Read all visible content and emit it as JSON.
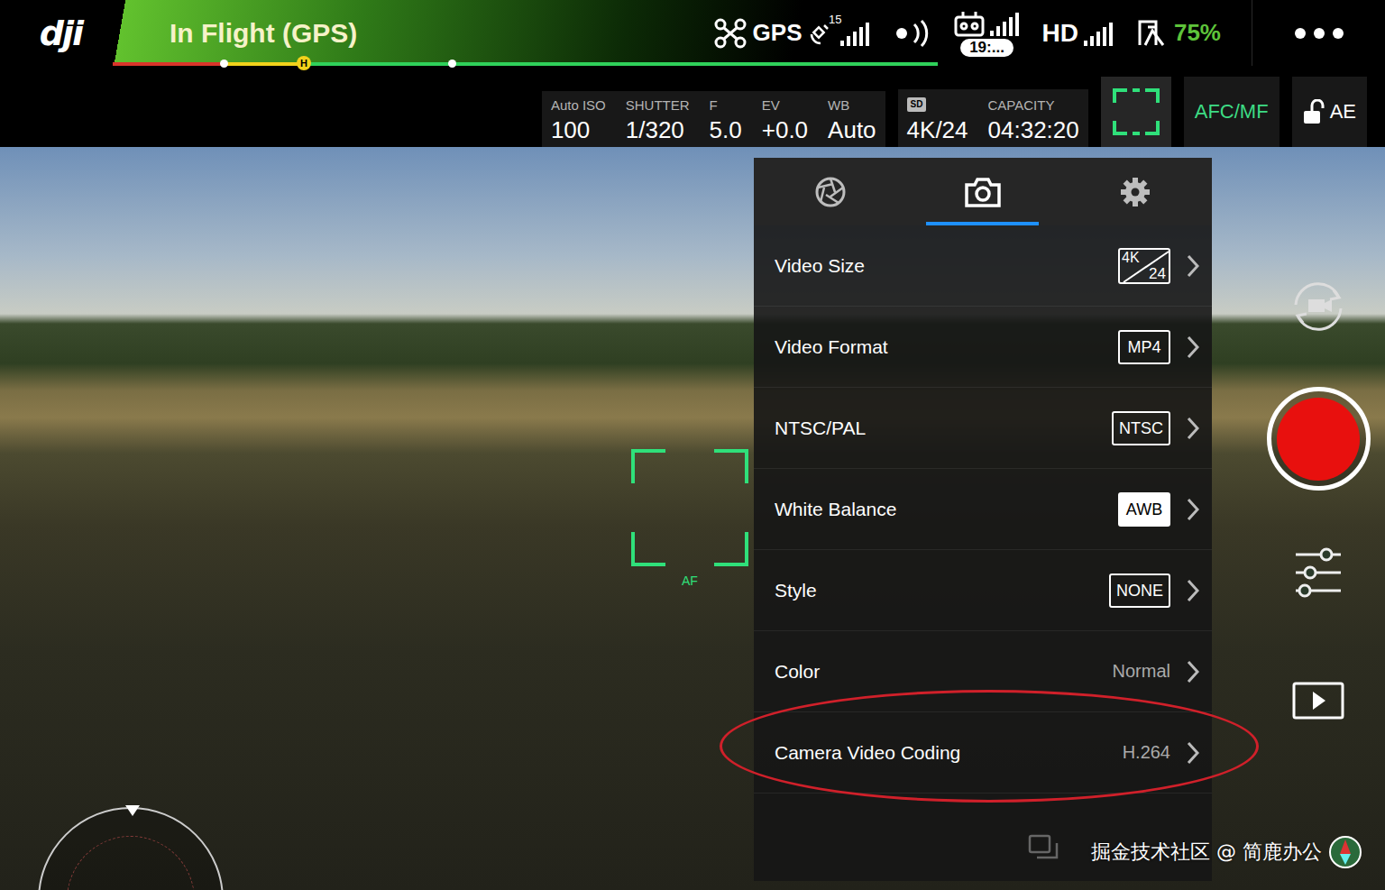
{
  "logo": "dji",
  "status": {
    "title": "In Flight (GPS)",
    "home_marker": "H"
  },
  "indicators": [
    {
      "kind": "gps",
      "label": "GPS",
      "count": "15",
      "level": 1
    },
    {
      "kind": "wifi"
    },
    {
      "kind": "remote",
      "reading": "19:...",
      "level": 1
    },
    {
      "kind": "hd",
      "label": "HD",
      "level": 1
    },
    {
      "kind": "battery",
      "reading": "75%"
    }
  ],
  "camera_params": [
    {
      "label": "Auto ISO",
      "value": "100"
    },
    {
      "label": "SHUTTER",
      "value": "1/320"
    },
    {
      "label": "F",
      "value": "5.0"
    },
    {
      "label": "EV",
      "value": "+0.0"
    },
    {
      "label": "WB",
      "value": "Auto"
    }
  ],
  "storage": [
    {
      "badge": "SD",
      "value": "4K/24"
    },
    {
      "label": "CAPACITY",
      "value": "04:32:20"
    }
  ],
  "focus_mode": "AFC/MF",
  "exposure_lock": {
    "label": "AE",
    "locked": false
  },
  "af_label": "AF",
  "menu": {
    "tabs": [
      {
        "kind": "exposure",
        "selected": false
      },
      {
        "kind": "camera",
        "selected": true
      },
      {
        "kind": "settings",
        "selected": false
      }
    ],
    "rows": [
      {
        "label": "Video Size",
        "kind": "resolution",
        "value": "4K",
        "sub": "24",
        "highlighted": false
      },
      {
        "label": "Video Format",
        "kind": "badge",
        "value": "MP4",
        "filled": false,
        "highlighted": false
      },
      {
        "label": "NTSC/PAL",
        "kind": "badge",
        "value": "NTSC",
        "filled": false,
        "highlighted": false
      },
      {
        "label": "White Balance",
        "kind": "badge",
        "value": "AWB",
        "filled": true,
        "highlighted": false
      },
      {
        "label": "Style",
        "kind": "badge",
        "value": "NONE",
        "filled": false,
        "highlighted": false
      },
      {
        "label": "Color",
        "kind": "text",
        "value": "Normal",
        "highlighted": false
      },
      {
        "label": "Camera Video Coding",
        "kind": "text",
        "value": "H.264",
        "highlighted": true
      }
    ]
  },
  "recording": false,
  "watermark": "掘金技术社区 @ 简鹿办公"
}
